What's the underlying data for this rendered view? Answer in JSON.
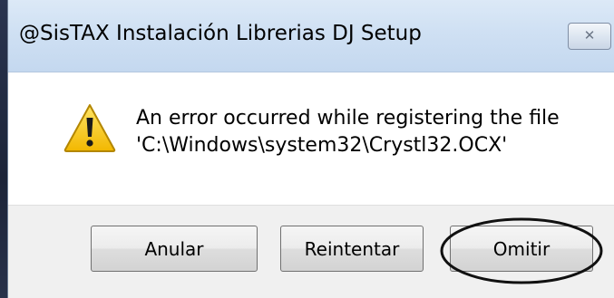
{
  "window": {
    "title": "@SisTAX Instalación Librerias DJ Setup",
    "close_glyph": "✕"
  },
  "dialog": {
    "icon": "warning-icon",
    "message_line1": "An error occurred while registering the file",
    "message_line2": "'C:\\Windows\\system32\\Crystl32.OCX'"
  },
  "buttons": {
    "abort_label": "Anular",
    "retry_label": "Reintentar",
    "ignore_label": "Omitir"
  },
  "colors": {
    "titlebar": "#cfe0f3",
    "dialog_background": "#ffffff",
    "button_bar": "#f0f0f0",
    "warning_yellow": "#f5c400"
  }
}
